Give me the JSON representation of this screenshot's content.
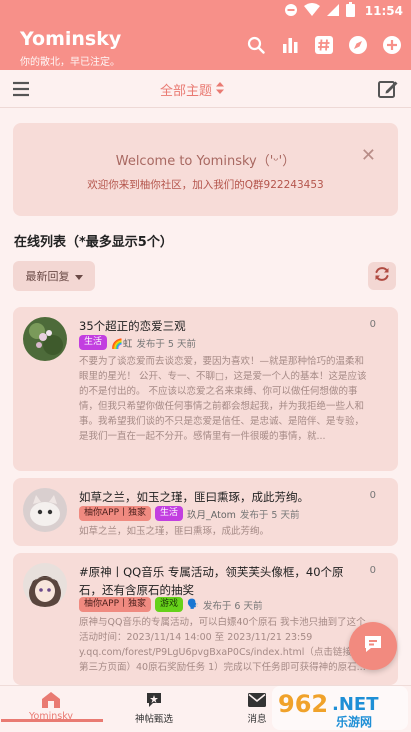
{
  "status_bar": {
    "time": "11:54"
  },
  "app": {
    "title": "Yominsky",
    "subtitle": "你的散北，早已注定。"
  },
  "toolbar": {
    "topic_label": "全部主题"
  },
  "welcome": {
    "title": "Welcome to Yominsky（'ᵕ'）",
    "description": "欢迎你来到柚你社区，加入我们的Q群922243453"
  },
  "section": {
    "title": "在线列表（*最多显示5个）",
    "sort_label": "最新回复"
  },
  "posts": [
    {
      "title": "35个超正的恋爱三观",
      "count": "0",
      "tag": "生活",
      "author": "🌈虹",
      "time": "发布于 5 天前",
      "excerpt": "不要为了谈恋爱而去谈恋爱，要因为喜欢！—就是那种恰巧的温柔和眼里的星光！ 公开、专一、不聊□，这是爱一个人的基本！这是应该的不是付出的。 不应该以恋爱之名来束缚、你可以做任何想做的事情，但我只希望你做任何事情之前都会想起我，并为我拒绝一些人和事。我希望我们谈的不只是恋爱是信任、是忠诚、是陪伴、是专验，是我们一直在一起不分开。感情里有一件很暖的事情，就..."
    },
    {
      "title": "如草之兰，如玉之瑾，匪曰熏琢，成此芳绚。",
      "count": "0",
      "tag1": "柚你APP丨独家",
      "tag2": "生活",
      "author": "玖月_Atom",
      "time": "发布于 5 天前",
      "excerpt": "如草之兰，如玉之瑾，匪曰熏琢，成此芳绚。"
    },
    {
      "title": "#原神丨QQ音乐 专属活动，领芙芙头像框，40个原石，还有含原石的抽奖",
      "count": "0",
      "tag1": "柚你APP丨独家",
      "tag2": "游戏",
      "author": "🗣️",
      "time": "发布于 6 天前",
      "excerpt": "原神与QQ音乐的专属活动，可以白嫖40个原石 我卡池只抽到了这个 活动时间：2023/11/14 14:00 至 2023/11/21 23:59 y.qq.com/forest/P9LgU6pvgBxaP0Cs/index.html（点击链接到第三方页面）40原石奖励任务 1）完成以下任务即可获得神的原石..."
    }
  ],
  "bottom_nav": [
    {
      "label": "Yominsky"
    },
    {
      "label": "神帖甄选"
    },
    {
      "label": "消息"
    }
  ],
  "watermark": "962.NET 乐游网",
  "colors": {
    "accent": "#f79089",
    "card": "#f7dcd8",
    "highlight": "#e97a72"
  }
}
